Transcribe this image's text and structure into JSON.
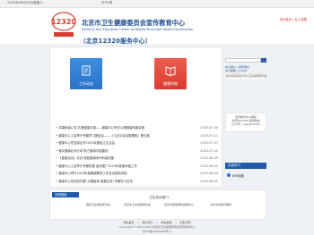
{
  "topbar": {
    "date": "2025年08月09日星期六",
    "weather": "天气:晴"
  },
  "header": {
    "title_zh": "北京市卫生健康委员会宣传教育中心",
    "title_en_line1": "Publicity and Education Center of Beijing Municipal Health Commission",
    "title_en_line2": "",
    "hotline": "（北京12320服务中心）",
    "right_text": "设为首页 | 加入收藏"
  },
  "tiles": [
    {
      "label": "工作动态",
      "color": "#2a72c9",
      "icon": "document-icon"
    },
    {
      "label": "健康科普",
      "color": "#d83c2f",
      "icon": "book-icon"
    }
  ],
  "news": [
    {
      "title": "• 共建和谐心态 共造健康中国——健康中心举办心理健康科普讲座",
      "date": "2025-07-30"
    },
    {
      "title": "• 健康中心工会举行专题学习报告会——《习近平谈治国理政》第五卷",
      "date": "2025-07-11"
    },
    {
      "title": "• 健康中心党支部召开2025年度民主生活会",
      "date": "2025-07-07"
    },
    {
      "title": "• 落实健康北京行动 助力健康中国建设",
      "date": "2025-07-02"
    },
    {
      "title": "• 《健康北京》杂志·家庭健康系列科普讲座",
      "date": "2025-06-29"
    },
    {
      "title": "• 健康中心工会举行专题党课 宣传推广2025年健康科普工作",
      "date": "2025-06-25"
    },
    {
      "title": "• 健康中心举行2025年度健康教育工作会议暨培训班",
      "date": "2025-06-24"
    },
    {
      "title": "• 健康中心党支部开展“大国医师 重要论述”专题学习交流",
      "date": "2025-06-20"
    }
  ],
  "side": {
    "search_placeholder": "",
    "links": [
      "中心简介 | 领导信息",
      "中心职能 | 12320"
    ],
    "panel1_lines": [
      "欢迎您来到北京市卫生健康委员会",
      "宣传教育中心网站",
      "北京市12320 健康热线",
      "(公众号：bjwsjj12320)"
    ],
    "panel_head": "在线学习",
    "panel_item": "BMI指数"
  },
  "links_bar": {
    "head": "友情链接",
    "title": "卫生热点部门",
    "items": [
      "国家卫生健康委员会",
      "北京市卫生健康委员会",
      "北京市疾病预防控制中心",
      "北京市中医管理局"
    ]
  },
  "footer": {
    "links": [
      "网站首页",
      "联系我们",
      "网站地图",
      "隐私声明"
    ],
    "line1": "版权所有 北京市卫生健康委员会宣传教育中心",
    "line2": "Copyright © 2009-2025  北京市卫生健康委员会宣传教育中心",
    "line3": "京ICP备05029008号-1"
  }
}
